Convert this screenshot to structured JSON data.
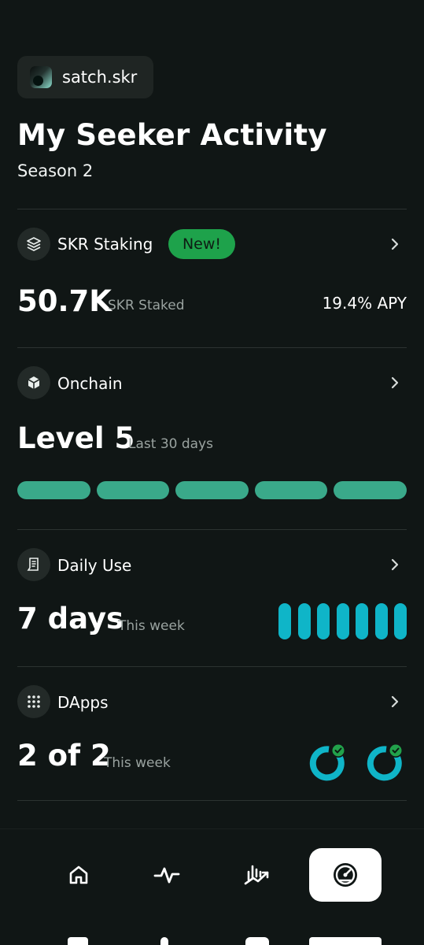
{
  "user": {
    "name": "satch.skr"
  },
  "header": {
    "title": "My Seeker Activity",
    "season": "Season 2"
  },
  "staking": {
    "label": "SKR Staking",
    "badge": "New!",
    "value": "50.7K",
    "value_label": "SKR Staked",
    "apy": "19.4% APY",
    "icon": "layers-icon"
  },
  "onchain": {
    "label": "Onchain",
    "value": "Level 5",
    "value_label": "Last 30 days",
    "levels_filled": 5,
    "levels_total": 5,
    "icon": "cube-icon"
  },
  "daily_use": {
    "label": "Daily Use",
    "value": "7 days",
    "value_label": "This week",
    "days_active": 7,
    "days_total": 7,
    "icon": "calendar-icon"
  },
  "dapps": {
    "label": "DApps",
    "value": "2 of 2",
    "value_label": "This week",
    "completed": 2,
    "total": 2,
    "icon": "grid-icon"
  },
  "nav": {
    "items": [
      {
        "name": "home",
        "icon": "home-icon",
        "active": false
      },
      {
        "name": "activity",
        "icon": "pulse-icon",
        "active": false
      },
      {
        "name": "markets",
        "icon": "chart-icon",
        "active": false
      },
      {
        "name": "seeker",
        "icon": "gauge-icon",
        "active": true
      }
    ]
  },
  "colors": {
    "background": "#101615",
    "badge_green": "#1ea24b",
    "level_green": "#3aa98a",
    "cyan": "#0fb5c8",
    "check_green": "#22a24b"
  }
}
